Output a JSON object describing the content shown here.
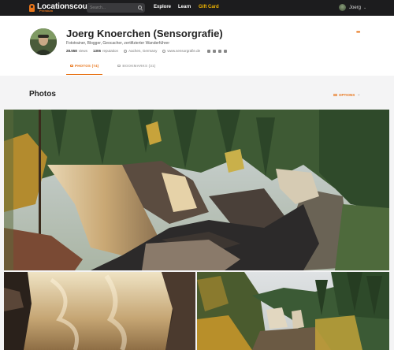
{
  "navbar": {
    "logo_text": "Locationscout",
    "logo_sub": "Premium",
    "search_placeholder": "Search...",
    "links": [
      "Explore",
      "Learn",
      "Gift Card"
    ],
    "user_name": "Joerg",
    "user_chevron": "⌄"
  },
  "profile": {
    "name": "Joerg Knoerchen (Sensorgrafie)",
    "tagline": "Fototrainer, Blogger, Geocacher, zertifizierter Wanderführer",
    "views_count": "28.558",
    "views_label": "views",
    "reputation_count": "1306",
    "reputation_label": "reputation",
    "location": "Aachen, Germany",
    "website": "www.sensorgrafie.de",
    "more_label": "•••"
  },
  "tabs": [
    {
      "label": "PHOTOS (74)",
      "active": true
    },
    {
      "label": "BOOKMARKS (31)",
      "active": false
    }
  ],
  "photos_section": {
    "title": "Photos",
    "options_label": "OPTIONS"
  },
  "colors": {
    "accent": "#e8751a",
    "navbar_bg": "#1c1c1e",
    "gift": "#f0b400"
  },
  "icons": [
    "search-icon",
    "eye-icon",
    "star-icon",
    "pin-icon",
    "globe-icon",
    "facebook-icon",
    "instagram-icon",
    "flickr-icon",
    "linkedin-icon",
    "sliders-icon"
  ]
}
